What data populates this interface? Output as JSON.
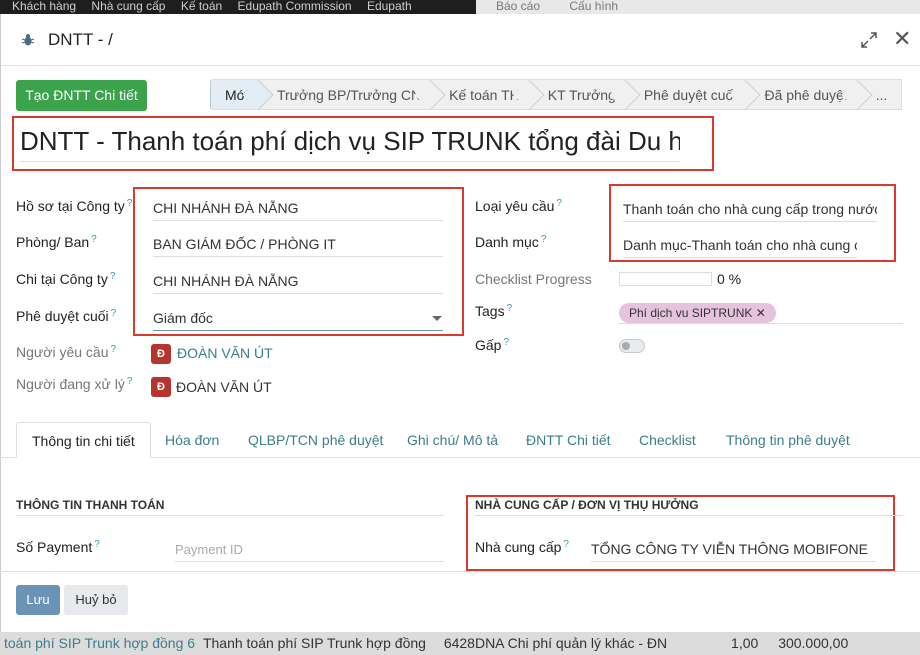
{
  "background": {
    "top_menu": [
      "Khách hàng",
      "Nhà cung cấp",
      "Kế toán",
      "Edupath Commission",
      "Edupath"
    ],
    "top_menu_right": [
      "Báo cáo",
      "Cấu hình"
    ],
    "bottom_row": {
      "col1": "toán phí SIP Trunk hợp đồng 6",
      "col2": "Thanh toán phí SIP Trunk  hợp đồng",
      "col3": "6428DNA Chi phí quản lý khác - ĐN",
      "col4": "1,00",
      "col5": "300.000,00"
    }
  },
  "modal": {
    "title": "DNTT - /",
    "create_button": "Tạo ĐNTT Chi tiết",
    "stages": [
      "Mới",
      "Trưởng BP/Trưởng CN",
      "Kế toán TH",
      "KT Trưởng",
      "Phê duyệt cuối",
      "Đã phê duyệt",
      "..."
    ],
    "active_stage": "Mới",
    "record_title": "DNTT - Thanh toán phí dịch vụ SIP TRUNK tổng đài Du học",
    "left_fields": [
      {
        "label": "Hồ sơ tại Công ty",
        "value": "CHI NHÁNH ĐÀ NẴNG"
      },
      {
        "label": "Phòng/ Ban",
        "value": "BAN GIÁM ĐỐC / PHÒNG IT"
      },
      {
        "label": "Chi tại Công ty",
        "value": "CHI NHÁNH ĐÀ NẴNG"
      },
      {
        "label": "Phê duyệt cuối",
        "value": "Giám đốc"
      }
    ],
    "requester": {
      "label": "Người yêu cầu",
      "avatar": "Đ",
      "name": "ĐOÀN VĂN ÚT"
    },
    "handler": {
      "label": "Người đang xử lý",
      "avatar": "Đ",
      "name": "ĐOÀN VĂN ÚT"
    },
    "right_fields": {
      "request_type": {
        "label": "Loại yêu cầu",
        "value": "Thanh toán cho nhà cung cấp trong nước"
      },
      "category": {
        "label": "Danh mục",
        "value": "Danh mục-Thanh toán cho nhà cung cấp"
      },
      "checklist": {
        "label": "Checklist Progress",
        "value": "0 %",
        "fraction": 0
      },
      "tags": {
        "label": "Tags",
        "tag": "Phí dịch vu SIPTRUNK",
        "remove": "✕"
      },
      "advance": {
        "label": "Gấp",
        "on": false
      }
    },
    "tabs": [
      "Thông tin chi tiết",
      "Hóa đơn",
      "QLBP/TCN phê duyệt",
      "Ghi chú/ Mô tả",
      "ĐNTT Chi tiết",
      "Checklist",
      "Thông tin phê duyệt"
    ],
    "payment_section": {
      "title": "THÔNG TIN THANH TOÁN",
      "payment_label": "Số Payment",
      "payment_placeholder": "Payment ID"
    },
    "vendor_section": {
      "title": "NHÀ CUNG CẤP / ĐƠN VỊ THỤ HƯỞNG",
      "vendor_label": "Nhà cung cấp",
      "vendor_value": "TỔNG CÔNG TY VIỄN THÔNG MOBIFONE"
    },
    "footer": {
      "save": "Lưu",
      "cancel": "Huỷ bỏ"
    },
    "help_mark": "?"
  },
  "colors": {
    "primary_green": "#3aa34b",
    "highlight_red": "#d83a2c",
    "link_teal": "#3b7d8c",
    "save_blue": "#6b93b5"
  }
}
